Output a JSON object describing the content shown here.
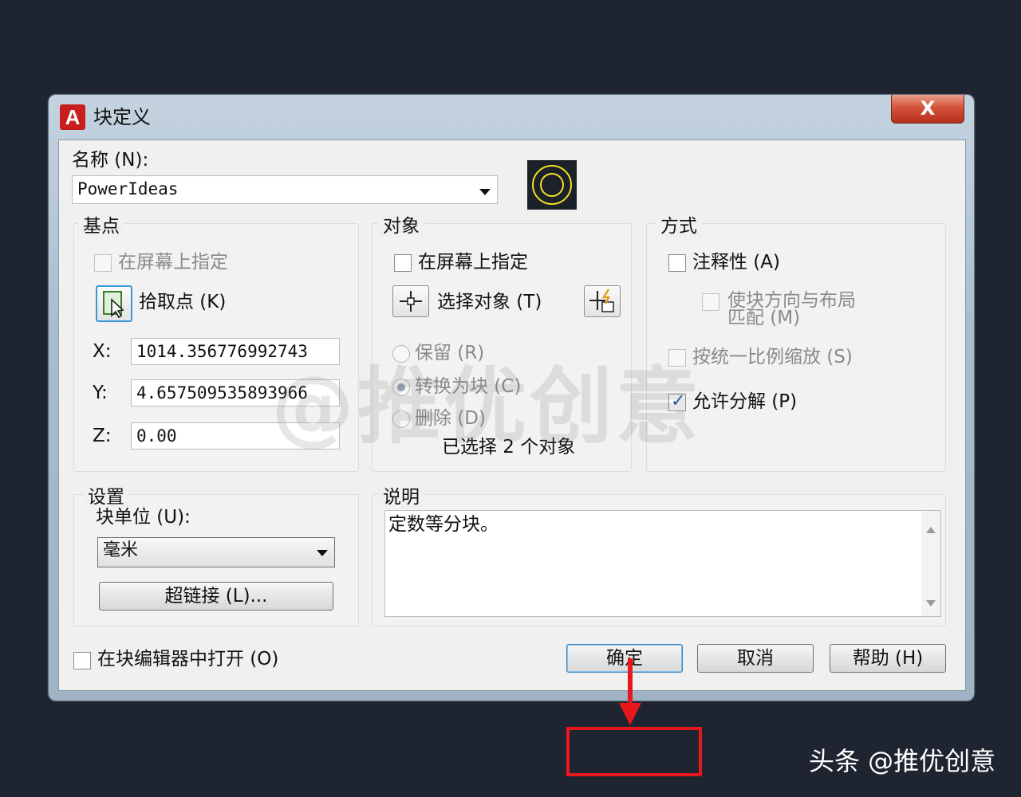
{
  "window": {
    "title": "块定义",
    "close_glyph": "X",
    "logo_letter": "A"
  },
  "name_field": {
    "label": "名称 (N):",
    "value": "PowerIdeas"
  },
  "base_point": {
    "title": "基点",
    "specify_on_screen": "在屏幕上指定",
    "pick_point": "拾取点 (K)",
    "x_label": "X:",
    "x_value": "1014.356776992743",
    "y_label": "Y:",
    "y_value": "4.657509535893966",
    "z_label": "Z:",
    "z_value": "0.00"
  },
  "objects": {
    "title": "对象",
    "specify_on_screen": "在屏幕上指定",
    "select_objects": "选择对象 (T)",
    "retain": "保留 (R)",
    "convert_to_block": "转换为块 (C)",
    "delete": "删除 (D)",
    "selected_count": "已选择 2 个对象"
  },
  "behavior": {
    "title": "方式",
    "annotative": "注释性 (A)",
    "match_orientation_line1": "使块方向与布局",
    "match_orientation_line2": "匹配 (M)",
    "scale_uniformly": "按统一比例缩放 (S)",
    "allow_exploding": "允许分解 (P)"
  },
  "settings": {
    "title": "设置",
    "block_unit_label": "块单位 (U):",
    "block_unit_value": "毫米",
    "hyperlink": "超链接 (L)..."
  },
  "description": {
    "title": "说明",
    "value": "定数等分块。"
  },
  "footer": {
    "open_in_editor": "在块编辑器中打开 (O)",
    "ok": "确定",
    "cancel": "取消",
    "help": "帮助 (H)"
  },
  "watermark": "@推优创意",
  "byline": "头条 @推优创意",
  "colors": {
    "highlight": "#e8161d",
    "preview_bg": "#1b2029",
    "preview_stroke": "#f0e02a"
  }
}
